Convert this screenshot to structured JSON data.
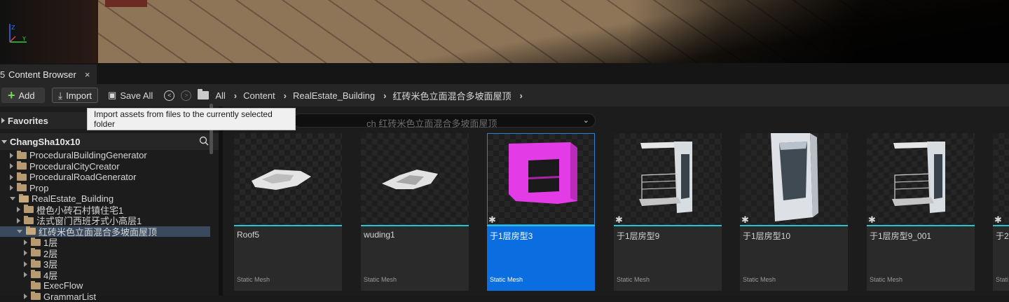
{
  "tab": {
    "icon": "content-browser-icon",
    "label": "Content Browser",
    "close": "×"
  },
  "toolbar": {
    "add_label": "Add",
    "import_label": "Import",
    "save_all_label": "Save All",
    "breadcrumbs": [
      "All",
      "Content",
      "RealEstate_Building",
      "红砖米色立面混合多坡面屋顶"
    ]
  },
  "tooltip": "Import assets from files to the currently selected folder",
  "search": {
    "placeholder": "Search 红砖米色立面混合多坡面屋顶",
    "visible_text": "ch 红砖米色立面混合多坡面屋顶"
  },
  "sidebar": {
    "favorites_label": "Favorites",
    "project_label": "ChangSha10x10",
    "tree": [
      {
        "label": "ProceduralBuildingGenerator",
        "indent": 1,
        "expanded": false
      },
      {
        "label": "ProceduralCityCreator",
        "indent": 1,
        "expanded": false
      },
      {
        "label": "ProceduralRoadGenerator",
        "indent": 1,
        "expanded": false
      },
      {
        "label": "Prop",
        "indent": 1,
        "expanded": false
      },
      {
        "label": "RealEstate_Building",
        "indent": 1,
        "expanded": true
      },
      {
        "label": "橙色小砖石村镇住宅1",
        "indent": 2,
        "expanded": false
      },
      {
        "label": "法式窗门西班牙式小高层1",
        "indent": 2,
        "expanded": false
      },
      {
        "label": "红砖米色立面混合多坡面屋顶",
        "indent": 2,
        "expanded": true,
        "selected": true
      },
      {
        "label": "1层",
        "indent": 3,
        "expanded": false
      },
      {
        "label": "2层",
        "indent": 3,
        "expanded": false
      },
      {
        "label": "3层",
        "indent": 3,
        "expanded": false
      },
      {
        "label": "4层",
        "indent": 3,
        "expanded": false
      },
      {
        "label": "ExecFlow",
        "indent": 3,
        "expanded": false,
        "leaf": true
      },
      {
        "label": "GrammarList",
        "indent": 3,
        "expanded": false
      }
    ]
  },
  "assets": [
    {
      "name": "Roof5",
      "type": "Static Mesh",
      "thumb": "roof-flat",
      "starred": false,
      "selected": false
    },
    {
      "name": "wuding1",
      "type": "Static Mesh",
      "thumb": "roof-sloped",
      "starred": false,
      "selected": false
    },
    {
      "name": "于1层房型3",
      "type": "Static Mesh",
      "thumb": "magenta-frame",
      "starred": true,
      "selected": true
    },
    {
      "name": "于1层房型9",
      "type": "Static Mesh",
      "thumb": "balcony",
      "starred": true,
      "selected": false
    },
    {
      "name": "于1层房型10",
      "type": "Static Mesh",
      "thumb": "wall-block",
      "starred": true,
      "selected": false
    },
    {
      "name": "于1层房型9_001",
      "type": "Static Mesh",
      "thumb": "balcony",
      "starred": true,
      "selected": false
    },
    {
      "name": "于2",
      "type": "Stati",
      "thumb": "partial",
      "starred": true,
      "selected": false
    }
  ],
  "colors": {
    "accent": "#0a6ee0",
    "underline": "#29c4d0",
    "magenta": "#e040e0",
    "folder": "#b59a72"
  }
}
